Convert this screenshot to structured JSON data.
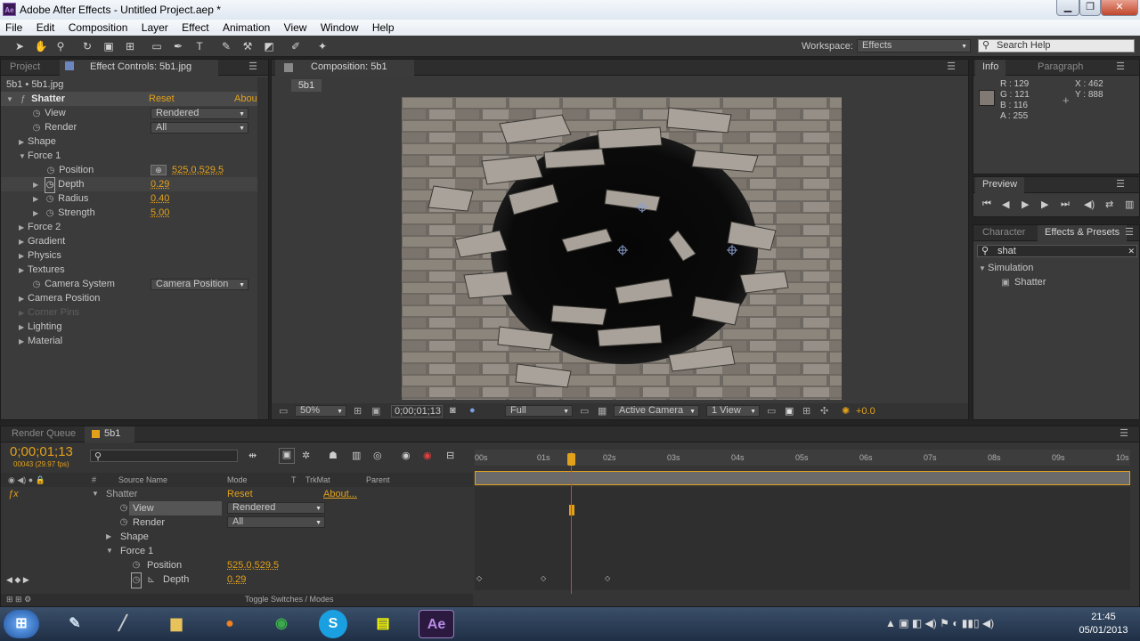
{
  "window": {
    "title": "Adobe After Effects - Untitled Project.aep *",
    "ae_badge": "Ae",
    "buttons": [
      "▁",
      "❐",
      "✕"
    ]
  },
  "menu": [
    "File",
    "Edit",
    "Composition",
    "Layer",
    "Effect",
    "Animation",
    "View",
    "Window",
    "Help"
  ],
  "toolbar": {
    "workspace_label": "Workspace:",
    "workspace_value": "Effects",
    "search_help": "Search Help"
  },
  "project_tab": "Project",
  "effect_controls": {
    "tab": "Effect Controls: 5b1.jpg",
    "layer_path": "5b1 • 5b1.jpg",
    "effect_name": "Shatter",
    "reset": "Reset",
    "about": "Abou",
    "view_label": "View",
    "view_value": "Rendered",
    "render_label": "Render",
    "render_value": "All",
    "shape": "Shape",
    "force1": "Force 1",
    "position_label": "Position",
    "position_value": "525.0,529.5",
    "depth_label": "Depth",
    "depth_value": "0.29",
    "radius_label": "Radius",
    "radius_value": "0.40",
    "strength_label": "Strength",
    "strength_value": "5.00",
    "force2": "Force 2",
    "gradient": "Gradient",
    "physics": "Physics",
    "textures": "Textures",
    "camera_system_label": "Camera System",
    "camera_system_value": "Camera Position",
    "camera_position": "Camera Position",
    "corner_pins": "Corner Pins",
    "lighting": "Lighting",
    "material": "Material"
  },
  "composition": {
    "tab": "Composition: 5b1",
    "crumb": "5b1",
    "zoom": "50%",
    "timecode": "0;00;01;13",
    "resolution": "Full",
    "camera": "Active Camera",
    "views": "1 View",
    "exposure": "+0.0"
  },
  "info": {
    "tab": "Info",
    "tab2": "Paragraph",
    "r": "R : 129",
    "g": "G : 121",
    "b": "B : 116",
    "a": "A : 255",
    "x": "X : 462",
    "y": "Y : 888"
  },
  "preview": {
    "tab": "Preview"
  },
  "effects_presets": {
    "tab1": "Character",
    "tab2": "Effects & Presets",
    "search": "shat",
    "category": "Simulation",
    "item": "Shatter"
  },
  "timeline": {
    "tab_render_queue": "Render Queue",
    "tab_comp": "5b1",
    "timecode": "0;00;01;13",
    "fps": "00043 (29.97 fps)",
    "col_source": "Source Name",
    "col_mode": "Mode",
    "col_t": "T",
    "col_trkmat": "TrkMat",
    "col_parent": "Parent",
    "ticks": [
      "00s",
      "01s",
      "02s",
      "03s",
      "04s",
      "05s",
      "06s",
      "07s",
      "08s",
      "09s",
      "10s"
    ],
    "shatter": "Shatter",
    "reset": "Reset",
    "about": "About...",
    "view": "View",
    "view_value": "Rendered",
    "render": "Render",
    "render_value": "All",
    "shape": "Shape",
    "force1": "Force 1",
    "position": "Position",
    "position_value": "525.0,529.5",
    "depth": "Depth",
    "depth_value": "0.29",
    "toggle": "Toggle Switches / Modes"
  },
  "taskbar": {
    "time": "21:45",
    "date": "05/01/2013"
  }
}
